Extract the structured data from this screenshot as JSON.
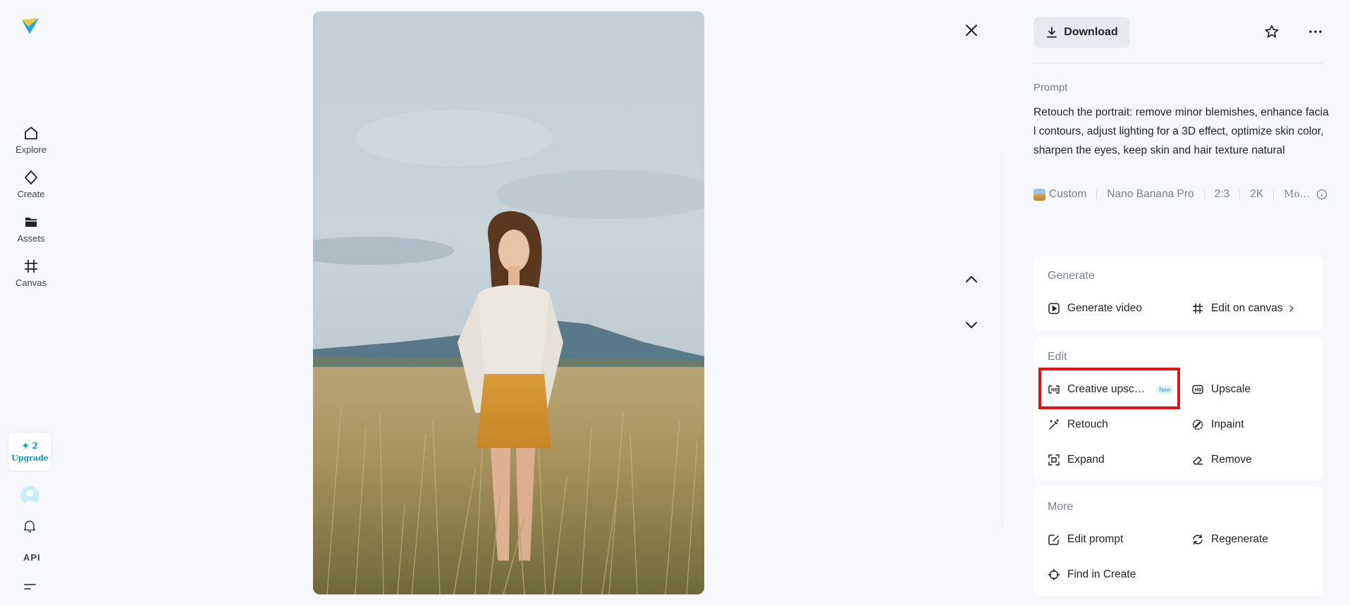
{
  "app": {
    "accent_color": "#1399b8",
    "highlight_color": "#e3131b"
  },
  "sidebar": {
    "items": [
      {
        "label": "Explore",
        "icon": "home-icon"
      },
      {
        "label": "Create",
        "icon": "diamond-icon"
      },
      {
        "label": "Assets",
        "icon": "folder-icon"
      },
      {
        "label": "Canvas",
        "icon": "crop-grid-icon"
      }
    ],
    "upgrade": {
      "credits": "✦ 2",
      "label": "Upgrade"
    },
    "api_label": "API"
  },
  "viewer": {
    "close_icon": "close-icon",
    "prev_icon": "chevron-up-icon",
    "next_icon": "chevron-down-icon"
  },
  "panel": {
    "download_label": "Download",
    "prompt_label": "Prompt",
    "prompt_text": "Retouch the portrait: remove minor blemishes, enhance facial contours, adjust lighting for a 3D effect, optimize skin color, sharpen the eyes, keep skin and hair texture natural",
    "meta": {
      "style": "Custom",
      "model": "Nano Banana Pro",
      "ratio": "2:3",
      "resolution": "2K",
      "more": "Mo…"
    },
    "generate": {
      "title": "Generate",
      "generate_video": "Generate video",
      "edit_on_canvas": "Edit on canvas"
    },
    "edit": {
      "title": "Edit",
      "creative_upscale": "Creative upsc…",
      "new_badge": "New",
      "upscale": "Upscale",
      "retouch": "Retouch",
      "inpaint": "Inpaint",
      "expand": "Expand",
      "remove": "Remove"
    },
    "more": {
      "title": "More",
      "edit_prompt": "Edit prompt",
      "regenerate": "Regenerate",
      "find_in_create": "Find in Create"
    }
  }
}
